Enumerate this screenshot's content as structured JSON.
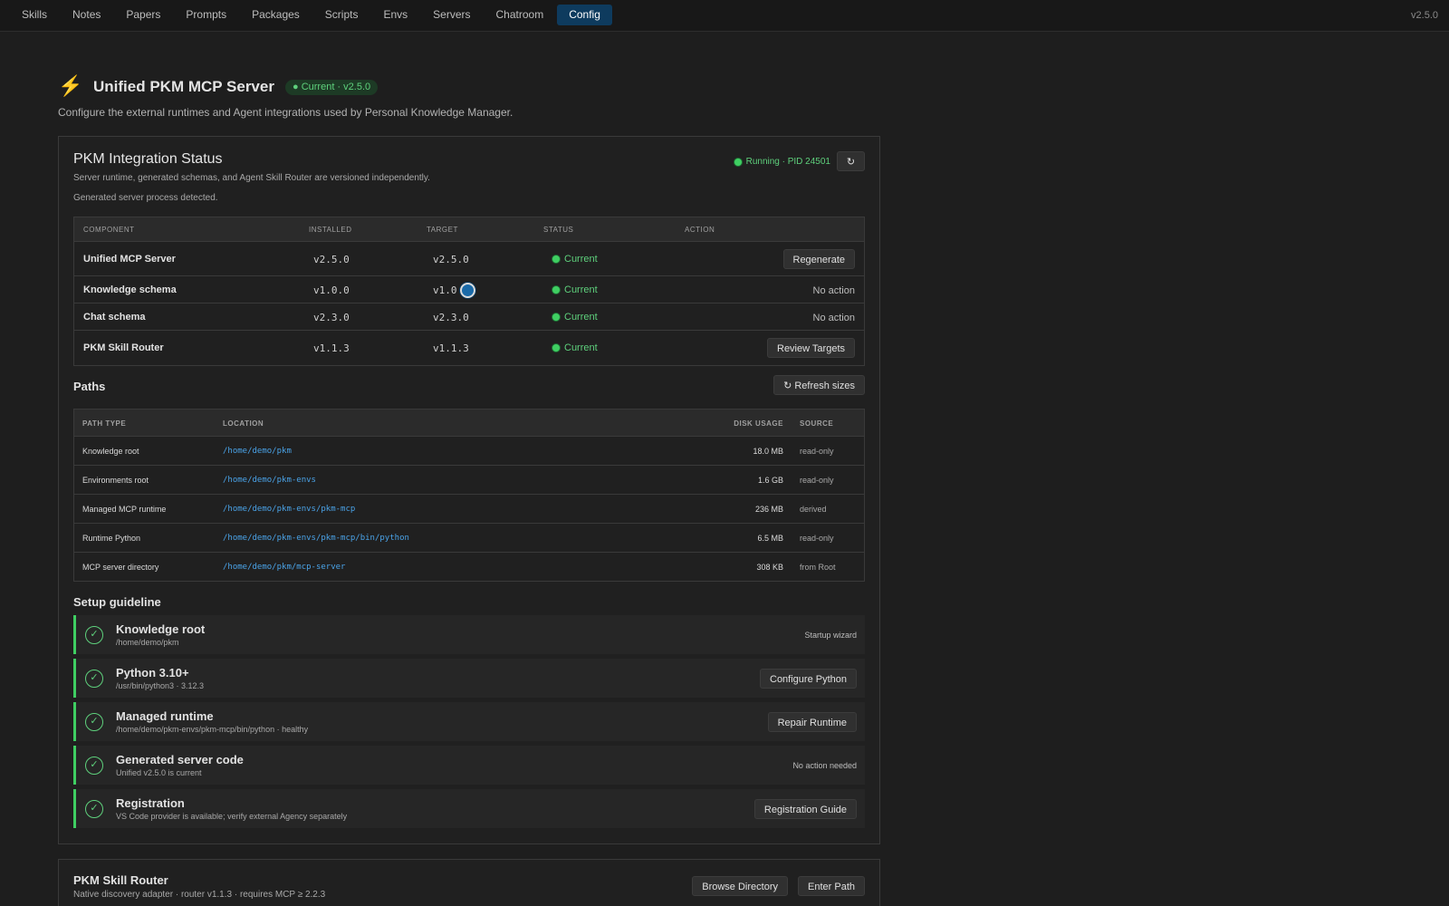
{
  "nav": {
    "tabs": [
      "Skills",
      "Notes",
      "Papers",
      "Prompts",
      "Packages",
      "Scripts",
      "Envs",
      "Servers",
      "Chatroom",
      "Config"
    ],
    "active": "Config",
    "version": "v2.5.0"
  },
  "header": {
    "icon": "lightning-icon",
    "title": "Unified PKM MCP Server",
    "badge": "● Current · v2.5.0",
    "subtitle": "Configure the external runtimes and Agent integrations used by Personal Knowledge Manager."
  },
  "integration": {
    "title": "PKM Integration Status",
    "subtitle": "Server runtime, generated schemas, and Agent Skill Router are versioned independently.",
    "note": "Generated server process detected.",
    "status": "Running · PID 24501",
    "refresh_icon": "↻",
    "columns": [
      "Component",
      "Installed",
      "Target",
      "Status",
      "Action"
    ],
    "rows": [
      {
        "component": "Unified MCP Server",
        "installed": "v2.5.0",
        "target": "v2.5.0",
        "status": "Current",
        "action": "Regenerate",
        "action_is_button": true
      },
      {
        "component": "Knowledge schema",
        "installed": "v1.0.0",
        "target": "v1.0",
        "status": "Current",
        "action": "No action",
        "action_is_button": false
      },
      {
        "component": "Chat schema",
        "installed": "v2.3.0",
        "target": "v2.3.0",
        "status": "Current",
        "action": "No action",
        "action_is_button": false
      },
      {
        "component": "PKM Skill Router",
        "installed": "v1.1.3",
        "target": "v1.1.3",
        "status": "Current",
        "action": "Review Targets",
        "action_is_button": true
      }
    ]
  },
  "paths": {
    "title": "Paths",
    "refresh_label": "↻ Refresh sizes",
    "columns": [
      "Path type",
      "Location",
      "Disk usage",
      "Source"
    ],
    "rows": [
      {
        "type": "Knowledge root",
        "location": "/home/demo/pkm",
        "size": "18.0 MB",
        "source": "read-only"
      },
      {
        "type": "Environments root",
        "location": "/home/demo/pkm-envs",
        "size": "1.6 GB",
        "source": "read-only"
      },
      {
        "type": "Managed MCP runtime",
        "location": "/home/demo/pkm-envs/pkm-mcp",
        "size": "236 MB",
        "source": "derived"
      },
      {
        "type": "Runtime Python",
        "location": "/home/demo/pkm-envs/pkm-mcp/bin/python",
        "size": "6.5 MB",
        "source": "read-only"
      },
      {
        "type": "MCP server directory",
        "location": "/home/demo/pkm/mcp-server",
        "size": "308 KB",
        "source": "from Root"
      }
    ]
  },
  "setup": {
    "title": "Setup guideline",
    "check_icon": "✓",
    "steps": [
      {
        "title": "Knowledge root",
        "sub": "/home/demo/pkm",
        "action": "Startup wizard",
        "action_is_button": false
      },
      {
        "title": "Python 3.10+",
        "sub": "/usr/bin/python3 · 3.12.3",
        "action": "Configure Python",
        "action_is_button": true
      },
      {
        "title": "Managed runtime",
        "sub": "/home/demo/pkm-envs/pkm-mcp/bin/python · healthy",
        "action": "Repair Runtime",
        "action_is_button": true
      },
      {
        "title": "Generated server code",
        "sub": "Unified v2.5.0 is current",
        "action": "No action needed",
        "action_is_button": false
      },
      {
        "title": "Registration",
        "sub": "VS Code provider is available; verify external Agency separately",
        "action": "Registration Guide",
        "action_is_button": true
      }
    ]
  },
  "router": {
    "title": "PKM Skill Router",
    "subtitle": "Native discovery adapter · router v1.1.3 · requires MCP ≥ 2.2.3",
    "browse_label": "Browse Directory",
    "enter_label": "Enter Path"
  }
}
